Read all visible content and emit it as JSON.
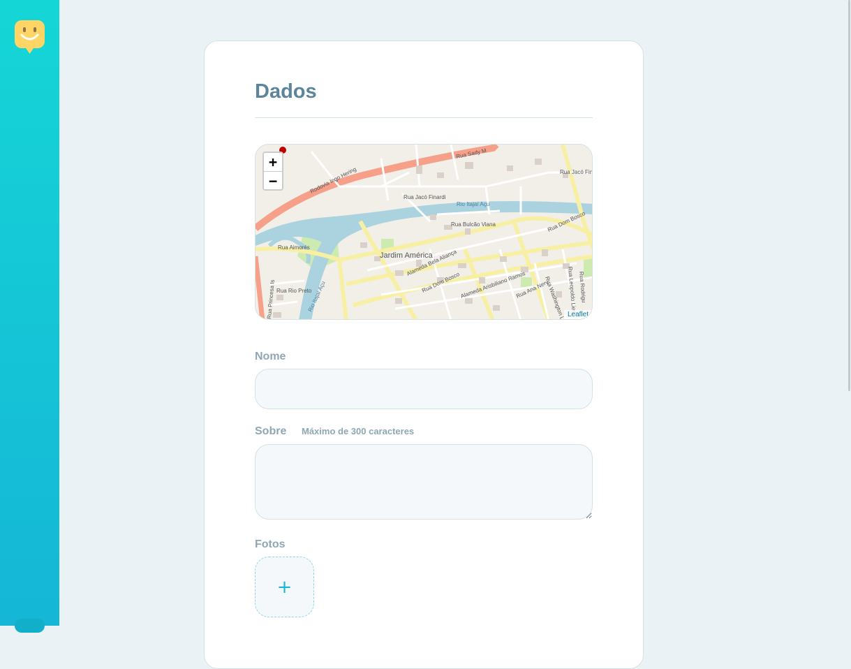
{
  "sidebar": {
    "logo_icon": "smile-chat-icon"
  },
  "form": {
    "title": "Dados",
    "map": {
      "zoom_in_label": "+",
      "zoom_out_label": "−",
      "attribution": "Leaflet",
      "street_labels": [
        "Rodovia Ingo Hering",
        "Rua Sady M",
        "Rua Jacó Finardi",
        "Rio Itajaí Açu",
        "Rua Bulcão Viana",
        "Rua Dom Bosco",
        "Jardim América",
        "Alameda Bela Aliança",
        "Rua Dom Bosco",
        "Alameda Arisbiliano Ramos",
        "Rua Aimorés",
        "Rua Rio Preto",
        "Rio Itajaí Açu",
        "Rua Princesa Is",
        "Rua Jacó Finardi",
        "Rua Ana Nery",
        "Rua Washington Luís",
        "Rua Leopoldo Lied",
        "Rua Rodrigu"
      ]
    },
    "name_label": "Nome",
    "name_value": "",
    "about_label": "Sobre",
    "about_note": "Máximo de 300 caracteres",
    "about_value": "",
    "photos_label": "Fotos",
    "add_photo_label": "+"
  },
  "colors": {
    "accent": "#15b6d6",
    "title": "#5c8599",
    "label": "#8fa7b3"
  }
}
